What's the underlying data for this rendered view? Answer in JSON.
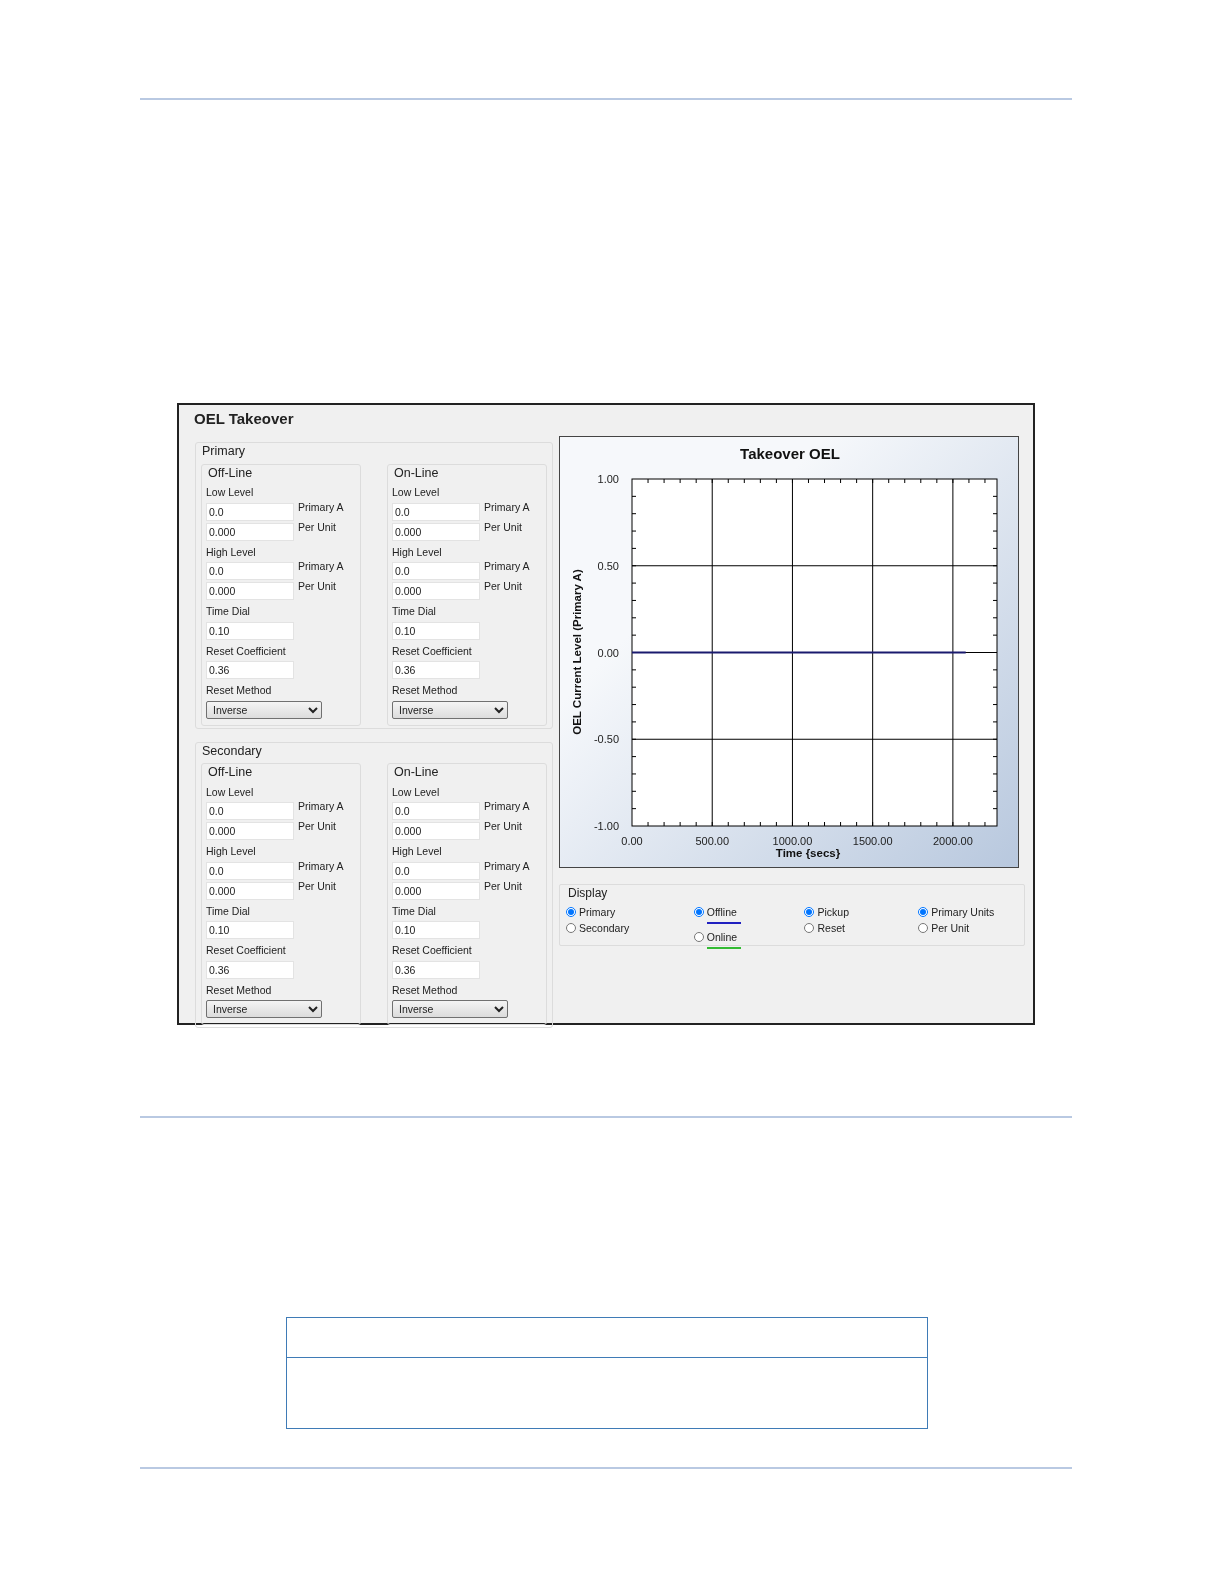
{
  "window": {
    "title": "OEL Takeover"
  },
  "groups": [
    {
      "title": "Primary",
      "sections": [
        {
          "title": "Off-Line",
          "items": [
            {
              "kind": "pair",
              "label": "Low Level",
              "fields": [
                {
                  "value": "0.0",
                  "unit": "Primary A"
                },
                {
                  "value": "0.000",
                  "unit": "Per Unit"
                }
              ]
            },
            {
              "kind": "pair",
              "label": "High Level",
              "fields": [
                {
                  "value": "0.0",
                  "unit": "Primary A"
                },
                {
                  "value": "0.000",
                  "unit": "Per Unit"
                }
              ]
            },
            {
              "kind": "single",
              "label": "Time Dial",
              "fields": [
                {
                  "value": "0.10"
                }
              ]
            },
            {
              "kind": "single",
              "label": "Reset Coefficient",
              "fields": [
                {
                  "value": "0.36"
                }
              ]
            },
            {
              "kind": "dropdown",
              "label": "Reset Method",
              "value": "Inverse"
            }
          ]
        },
        {
          "title": "On-Line",
          "items": [
            {
              "kind": "pair",
              "label": "Low Level",
              "fields": [
                {
                  "value": "0.0",
                  "unit": "Primary A"
                },
                {
                  "value": "0.000",
                  "unit": "Per Unit"
                }
              ]
            },
            {
              "kind": "pair",
              "label": "High Level",
              "fields": [
                {
                  "value": "0.0",
                  "unit": "Primary A"
                },
                {
                  "value": "0.000",
                  "unit": "Per Unit"
                }
              ]
            },
            {
              "kind": "single",
              "label": "Time Dial",
              "fields": [
                {
                  "value": "0.10"
                }
              ]
            },
            {
              "kind": "single",
              "label": "Reset Coefficient",
              "fields": [
                {
                  "value": "0.36"
                }
              ]
            },
            {
              "kind": "dropdown",
              "label": "Reset Method",
              "value": "Inverse"
            }
          ]
        }
      ]
    },
    {
      "title": "Secondary",
      "sections": [
        {
          "title": "Off-Line",
          "items": [
            {
              "kind": "pair",
              "label": "Low Level",
              "fields": [
                {
                  "value": "0.0",
                  "unit": "Primary A"
                },
                {
                  "value": "0.000",
                  "unit": "Per Unit"
                }
              ]
            },
            {
              "kind": "pair",
              "label": "High Level",
              "fields": [
                {
                  "value": "0.0",
                  "unit": "Primary A"
                },
                {
                  "value": "0.000",
                  "unit": "Per Unit"
                }
              ]
            },
            {
              "kind": "single",
              "label": "Time Dial",
              "fields": [
                {
                  "value": "0.10"
                }
              ]
            },
            {
              "kind": "single",
              "label": "Reset Coefficient",
              "fields": [
                {
                  "value": "0.36"
                }
              ]
            },
            {
              "kind": "dropdown",
              "label": "Reset Method",
              "value": "Inverse"
            }
          ]
        },
        {
          "title": "On-Line",
          "items": [
            {
              "kind": "pair",
              "label": "Low Level",
              "fields": [
                {
                  "value": "0.0",
                  "unit": "Primary A"
                },
                {
                  "value": "0.000",
                  "unit": "Per Unit"
                }
              ]
            },
            {
              "kind": "pair",
              "label": "High Level",
              "fields": [
                {
                  "value": "0.0",
                  "unit": "Primary A"
                },
                {
                  "value": "0.000",
                  "unit": "Per Unit"
                }
              ]
            },
            {
              "kind": "single",
              "label": "Time Dial",
              "fields": [
                {
                  "value": "0.10"
                }
              ]
            },
            {
              "kind": "single",
              "label": "Reset Coefficient",
              "fields": [
                {
                  "value": "0.36"
                }
              ]
            },
            {
              "kind": "dropdown",
              "label": "Reset Method",
              "value": "Inverse"
            }
          ]
        }
      ]
    }
  ],
  "chart": {
    "chart_data": {
      "type": "line",
      "title": "Takeover OEL",
      "xlabel": "Time {secs}",
      "ylabel": "OEL Current Level (Primary A)",
      "x": [
        0,
        2080
      ],
      "grid": true,
      "series": [
        {
          "color": "#1a1a6e",
          "values": [
            0,
            0
          ]
        }
      ],
      "xlim": [
        0,
        2275
      ],
      "ylim": [
        -1,
        1
      ],
      "xticks": [
        {
          "value": 0,
          "label": "0.00"
        },
        {
          "value": 500,
          "label": "500.00"
        },
        {
          "value": 1000,
          "label": "1000.00"
        },
        {
          "value": 1500,
          "label": "1500.00"
        },
        {
          "value": 2000,
          "label": "2000.00"
        }
      ],
      "yticks": [
        {
          "value": -1,
          "label": "-1.00"
        },
        {
          "value": -0.5,
          "label": "-0.50"
        },
        {
          "value": 0,
          "label": "0.00"
        },
        {
          "value": 0.5,
          "label": "0.50"
        },
        {
          "value": 1,
          "label": "1.00"
        }
      ]
    }
  },
  "display": {
    "title": "Display",
    "columns": [
      [
        {
          "label": "Primary",
          "selected": true
        },
        {
          "label": "Secondary",
          "selected": false
        }
      ],
      [
        {
          "label": "Offline",
          "selected": true,
          "color": "#2020c0"
        },
        {
          "label": "Online",
          "selected": false,
          "color": "#33bb33"
        }
      ],
      [
        {
          "label": "Pickup",
          "selected": true
        },
        {
          "label": "Reset",
          "selected": false
        }
      ],
      [
        {
          "label": "Primary Units",
          "selected": true
        },
        {
          "label": "Per Unit",
          "selected": false
        }
      ]
    ]
  }
}
